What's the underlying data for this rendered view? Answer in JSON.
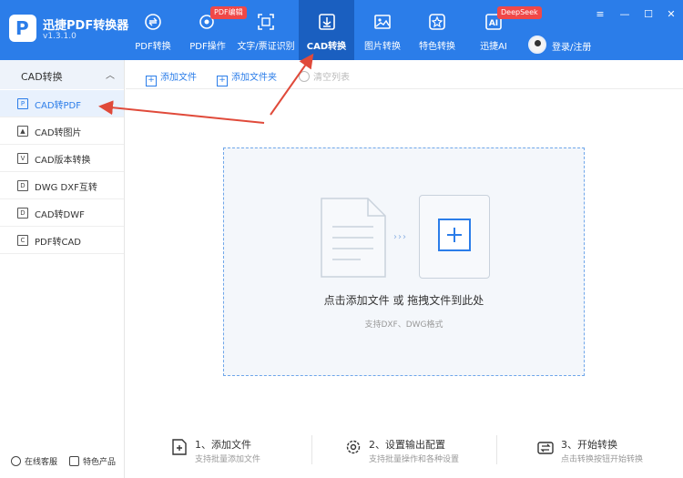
{
  "app": {
    "name": "迅捷PDF转换器",
    "version": "v1.3.1.0"
  },
  "nav": [
    {
      "label": "PDF转换",
      "icon": "pdf-convert-icon"
    },
    {
      "label": "PDF操作",
      "icon": "pdf-operate-icon",
      "badge": "PDF编辑"
    },
    {
      "label": "文字/票证识别",
      "icon": "ocr-icon"
    },
    {
      "label": "CAD转换",
      "icon": "cad-icon",
      "active": true
    },
    {
      "label": "图片转换",
      "icon": "image-icon"
    },
    {
      "label": "特色转换",
      "icon": "star-icon"
    },
    {
      "label": "迅捷AI",
      "icon": "ai-icon",
      "badge": "DeepSeek"
    }
  ],
  "user": {
    "login_label": "登录/注册"
  },
  "window_controls": {
    "menu": "≡",
    "minimize": "—",
    "maximize": "☐",
    "close": "✕"
  },
  "sidebar": {
    "header": "CAD转换",
    "items": [
      {
        "label": "CAD转PDF",
        "icon": "pdf-file-icon",
        "active": true
      },
      {
        "label": "CAD转图片",
        "icon": "image-file-icon"
      },
      {
        "label": "CAD版本转换",
        "icon": "version-icon"
      },
      {
        "label": "DWG DXF互转",
        "icon": "dwg-file-icon"
      },
      {
        "label": "CAD转DWF",
        "icon": "dwf-file-icon"
      },
      {
        "label": "PDF转CAD",
        "icon": "cad-file-icon"
      }
    ],
    "footer": {
      "support": "在线客服",
      "products": "特色产品"
    }
  },
  "toolbar": {
    "add_file": "添加文件",
    "add_folder": "添加文件夹",
    "clear_list": "清空列表"
  },
  "dropzone": {
    "main": "点击添加文件 或 拖拽文件到此处",
    "sub": "支持DXF、DWG格式"
  },
  "steps": [
    {
      "title": "1、添加文件",
      "desc": "支持批量添加文件",
      "icon": "add-file-icon"
    },
    {
      "title": "2、设置输出配置",
      "desc": "支持批量操作和各种设置",
      "icon": "settings-icon"
    },
    {
      "title": "3、开始转换",
      "desc": "点击转换按钮开始转换",
      "icon": "convert-icon"
    }
  ],
  "colors": {
    "accent": "#2b7de9",
    "active_nav": "#1a5fc0",
    "badge": "#f04848",
    "annotation_arrow": "#e04a3a"
  }
}
